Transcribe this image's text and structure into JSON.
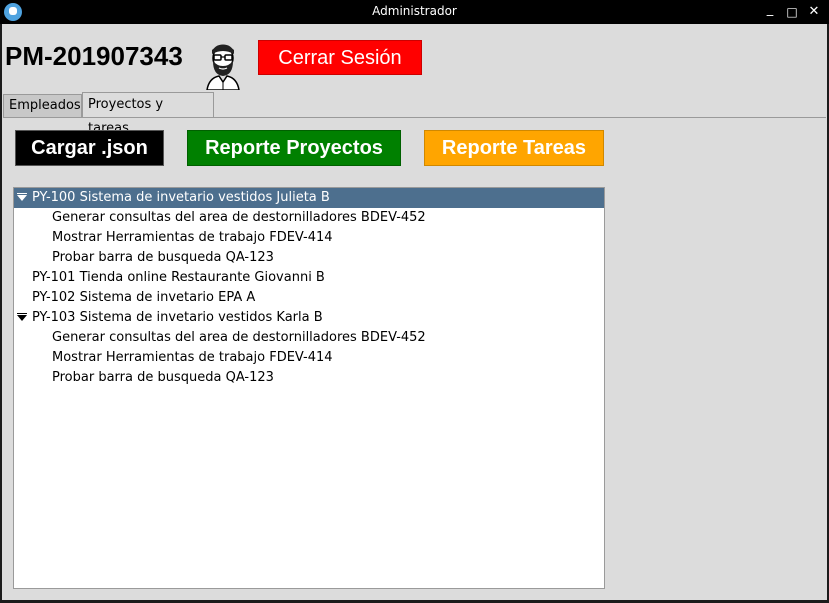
{
  "window": {
    "title": "Administrador",
    "minimize_glyph": "_",
    "maximize_glyph": "□",
    "close_glyph": "✕"
  },
  "header": {
    "user_id": "PM-201907343",
    "avatar_icon": "bearded-man-avatar-icon",
    "logout_label": "Cerrar Sesión"
  },
  "tabs": [
    {
      "label": "Empleados",
      "active": false
    },
    {
      "label": "Proyectos y tareas",
      "active": true
    }
  ],
  "actions": {
    "load_label": "Cargar .json",
    "projects_report_label": "Reporte Proyectos",
    "tasks_report_label": "Reporte Tareas"
  },
  "colors": {
    "logout": "#ff0000",
    "load": "#000000",
    "projects_report": "#008000",
    "tasks_report": "#ffa500",
    "selection": "#4d6f8e"
  },
  "tree": [
    {
      "label": "PY-100 Sistema de invetario vestidos Julieta B",
      "level": 0,
      "expanded": true,
      "selected": true
    },
    {
      "label": "Generar consultas del area de destornilladores BDEV-452",
      "level": 1
    },
    {
      "label": "Mostrar Herramientas de trabajo FDEV-414",
      "level": 1
    },
    {
      "label": "Probar barra de busqueda QA-123",
      "level": 1
    },
    {
      "label": "PY-101 Tienda online Restaurante Giovanni B",
      "level": 0,
      "expanded": false
    },
    {
      "label": "PY-102 Sistema de invetario EPA A",
      "level": 0,
      "expanded": false
    },
    {
      "label": "PY-103 Sistema de invetario vestidos Karla B",
      "level": 0,
      "expanded": true
    },
    {
      "label": "Generar consultas del area de destornilladores BDEV-452",
      "level": 1
    },
    {
      "label": "Mostrar Herramientas de trabajo FDEV-414",
      "level": 1
    },
    {
      "label": "Probar barra de busqueda QA-123",
      "level": 1
    }
  ]
}
